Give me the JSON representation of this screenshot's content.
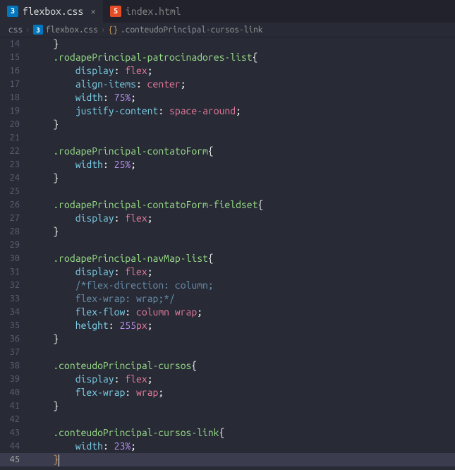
{
  "tabs": [
    {
      "icon": "css",
      "label": "flexbox.css",
      "active": true,
      "close": true
    },
    {
      "icon": "html",
      "label": "index.html",
      "active": false,
      "close": false
    }
  ],
  "breadcrumb": {
    "parts": [
      "css",
      "flexbox.css",
      ".conteudoPrincipal-cursos-link"
    ],
    "icons": [
      "",
      "css",
      "sym"
    ]
  },
  "close_glyph": "×",
  "chev": "›",
  "code": {
    "lines": [
      {
        "n": 14,
        "t": [
          [
            "pu",
            "    }"
          ]
        ]
      },
      {
        "n": 15,
        "t": [
          [
            "pu",
            "    "
          ],
          [
            "sel",
            ".rodapePrincipal-patrocinadores-list"
          ],
          [
            "pu",
            "{"
          ]
        ]
      },
      {
        "n": 16,
        "t": [
          [
            "pu",
            "        "
          ],
          [
            "prop",
            "display"
          ],
          [
            "pu",
            ": "
          ],
          [
            "val",
            "flex"
          ],
          [
            "pu",
            ";"
          ]
        ]
      },
      {
        "n": 17,
        "t": [
          [
            "pu",
            "        "
          ],
          [
            "prop",
            "align-items"
          ],
          [
            "pu",
            ": "
          ],
          [
            "val",
            "center"
          ],
          [
            "pu",
            ";"
          ]
        ]
      },
      {
        "n": 18,
        "t": [
          [
            "pu",
            "        "
          ],
          [
            "prop",
            "width"
          ],
          [
            "pu",
            ": "
          ],
          [
            "num",
            "75%"
          ],
          [
            "pu",
            ";"
          ]
        ]
      },
      {
        "n": 19,
        "t": [
          [
            "pu",
            "        "
          ],
          [
            "prop",
            "justify-content"
          ],
          [
            "pu",
            ": "
          ],
          [
            "val",
            "space-around"
          ],
          [
            "pu",
            ";"
          ]
        ]
      },
      {
        "n": 20,
        "t": [
          [
            "pu",
            "    }"
          ]
        ]
      },
      {
        "n": 21,
        "t": []
      },
      {
        "n": 22,
        "t": [
          [
            "pu",
            "    "
          ],
          [
            "sel",
            ".rodapePrincipal-contatoForm"
          ],
          [
            "pu",
            "{"
          ]
        ]
      },
      {
        "n": 23,
        "t": [
          [
            "pu",
            "        "
          ],
          [
            "prop",
            "width"
          ],
          [
            "pu",
            ": "
          ],
          [
            "num",
            "25%"
          ],
          [
            "pu",
            ";"
          ]
        ]
      },
      {
        "n": 24,
        "t": [
          [
            "pu",
            "    }"
          ]
        ]
      },
      {
        "n": 25,
        "t": []
      },
      {
        "n": 26,
        "t": [
          [
            "pu",
            "    "
          ],
          [
            "sel",
            ".rodapePrincipal-contatoForm-fieldset"
          ],
          [
            "pu",
            "{"
          ]
        ]
      },
      {
        "n": 27,
        "t": [
          [
            "pu",
            "        "
          ],
          [
            "prop",
            "display"
          ],
          [
            "pu",
            ": "
          ],
          [
            "val",
            "flex"
          ],
          [
            "pu",
            ";"
          ]
        ]
      },
      {
        "n": 28,
        "t": [
          [
            "pu",
            "    }"
          ]
        ]
      },
      {
        "n": 29,
        "t": []
      },
      {
        "n": 30,
        "t": [
          [
            "pu",
            "    "
          ],
          [
            "sel",
            ".rodapePrincipal-navMap-list"
          ],
          [
            "pu",
            "{"
          ]
        ]
      },
      {
        "n": 31,
        "t": [
          [
            "pu",
            "        "
          ],
          [
            "prop",
            "display"
          ],
          [
            "pu",
            ": "
          ],
          [
            "val",
            "flex"
          ],
          [
            "pu",
            ";"
          ]
        ]
      },
      {
        "n": 32,
        "t": [
          [
            "pu",
            "        "
          ],
          [
            "cm",
            "/*flex-direction: column;"
          ]
        ]
      },
      {
        "n": 33,
        "t": [
          [
            "pu",
            "        "
          ],
          [
            "cm",
            "flex-wrap: wrap;*/"
          ]
        ]
      },
      {
        "n": 34,
        "t": [
          [
            "pu",
            "        "
          ],
          [
            "prop",
            "flex-flow"
          ],
          [
            "pu",
            ": "
          ],
          [
            "val",
            "column"
          ],
          [
            "pu",
            " "
          ],
          [
            "val",
            "wrap"
          ],
          [
            "pu",
            ";"
          ]
        ]
      },
      {
        "n": 35,
        "t": [
          [
            "pu",
            "        "
          ],
          [
            "prop",
            "height"
          ],
          [
            "pu",
            ": "
          ],
          [
            "num",
            "255"
          ],
          [
            "unit",
            "px"
          ],
          [
            "pu",
            ";"
          ]
        ]
      },
      {
        "n": 36,
        "t": [
          [
            "pu",
            "    }"
          ]
        ]
      },
      {
        "n": 37,
        "t": []
      },
      {
        "n": 38,
        "t": [
          [
            "pu",
            "    "
          ],
          [
            "sel",
            ".conteudoPrincipal-cursos"
          ],
          [
            "pu",
            "{"
          ]
        ]
      },
      {
        "n": 39,
        "t": [
          [
            "pu",
            "        "
          ],
          [
            "prop",
            "display"
          ],
          [
            "pu",
            ": "
          ],
          [
            "val",
            "flex"
          ],
          [
            "pu",
            ";"
          ]
        ]
      },
      {
        "n": 40,
        "t": [
          [
            "pu",
            "        "
          ],
          [
            "prop",
            "flex-wrap"
          ],
          [
            "pu",
            ": "
          ],
          [
            "val",
            "wrap"
          ],
          [
            "pu",
            ";"
          ]
        ]
      },
      {
        "n": 41,
        "t": [
          [
            "pu",
            "    }"
          ]
        ]
      },
      {
        "n": 42,
        "t": []
      },
      {
        "n": 43,
        "t": [
          [
            "pu",
            "    "
          ],
          [
            "sel",
            ".conteudoPrincipal-cursos-link"
          ],
          [
            "pu",
            "{"
          ]
        ]
      },
      {
        "n": 44,
        "t": [
          [
            "pu",
            "        "
          ],
          [
            "prop",
            "width"
          ],
          [
            "pu",
            ": "
          ],
          [
            "num",
            "23%"
          ],
          [
            "pu",
            ";"
          ]
        ]
      },
      {
        "n": 45,
        "t": [
          [
            "pu",
            "    "
          ],
          [
            "kw",
            "}"
          ]
        ],
        "hl": true,
        "cursor": true
      }
    ]
  }
}
